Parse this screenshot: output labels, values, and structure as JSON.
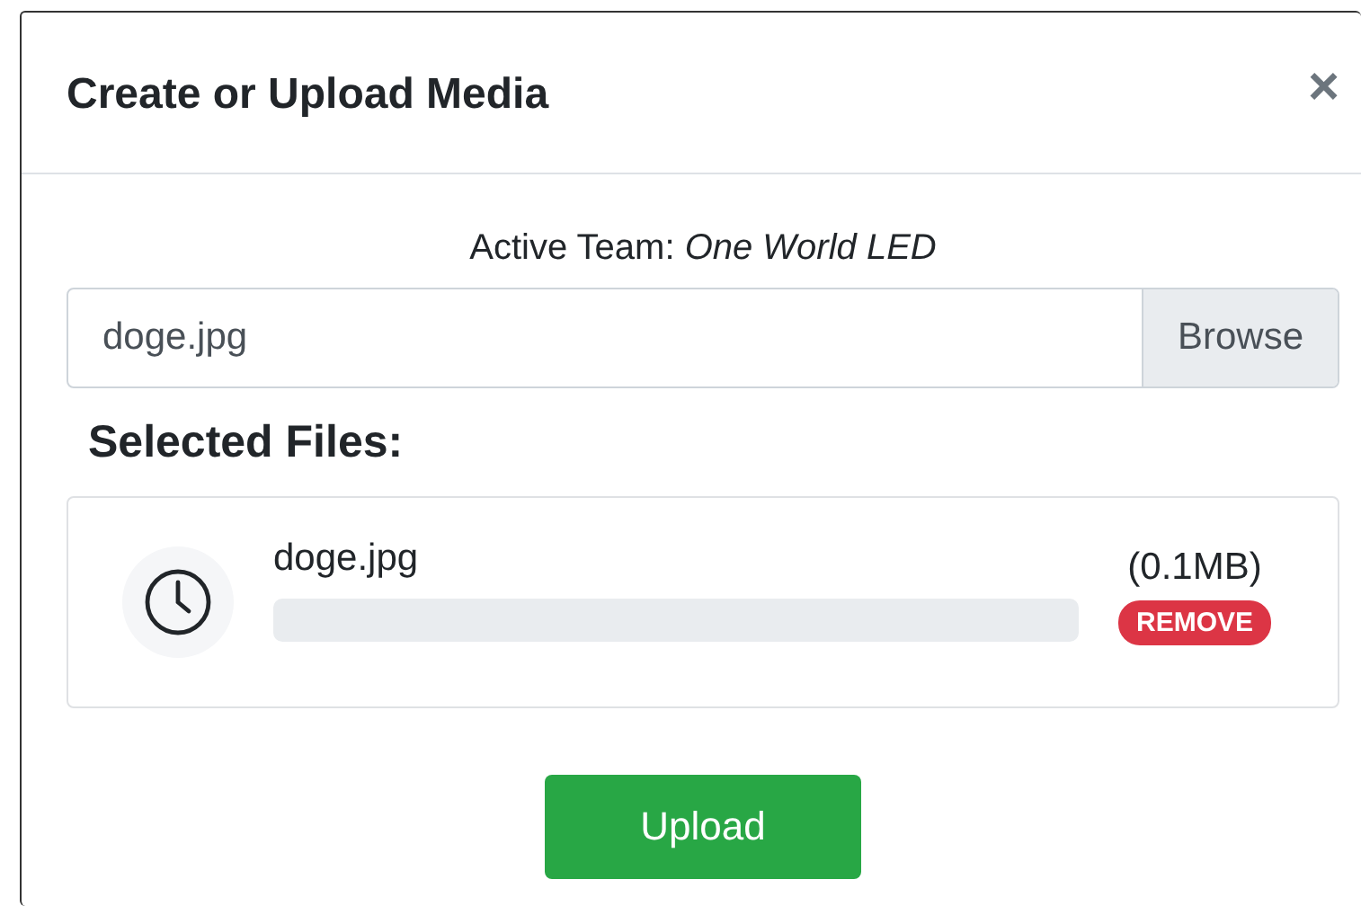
{
  "modal": {
    "title": "Create or Upload Media",
    "close": "×"
  },
  "active_team": {
    "label": "Active Team: ",
    "team": "One World LED"
  },
  "file_input": {
    "value": "doge.jpg",
    "button": "Browse"
  },
  "selected_heading": "Selected Files:",
  "files": [
    {
      "name": "doge.jpg",
      "size": "(0.1MB)",
      "level": 0,
      "remove": "REMOVE"
    }
  ],
  "buttons": [
    "Upload"
  ]
}
